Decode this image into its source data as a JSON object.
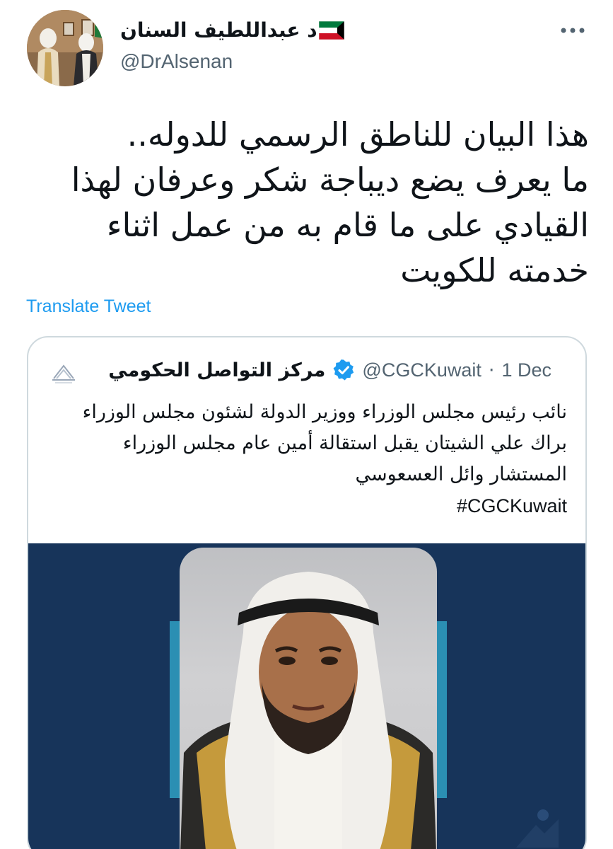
{
  "author": {
    "display_name": "د عبداللطيف السنان",
    "handle": "@DrAlsenan",
    "flag_icon": "kuwait-flag-icon"
  },
  "tweet": {
    "text": "هذا البيان للناطق الرسمي للدوله..\nما يعرف يضع ديباجة شكر وعرفان لهذا\nالقيادي على ما قام به من عمل اثناء\nخدمته للكويت",
    "translate_label": "Translate Tweet"
  },
  "quoted_tweet": {
    "name": "مركز التواصل الحكومي",
    "handle": "@CGCKuwait",
    "separator": "·",
    "date": "1 Dec",
    "text": "نائب رئيس مجلس الوزراء ووزير الدولة لشئون مجلس الوزراء براك علي الشيتان يقبل استقالة أمين عام مجلس الوزراء المستشار وائل العسعوسي",
    "hashtag": "#CGCKuwait"
  },
  "colors": {
    "link": "#1d9bf0",
    "secondary_text": "#536471",
    "verified_badge": "#1d9bf0",
    "image_background": "#17345a",
    "image_accent": "#2b8fb3",
    "card_border": "#cfd9de"
  }
}
